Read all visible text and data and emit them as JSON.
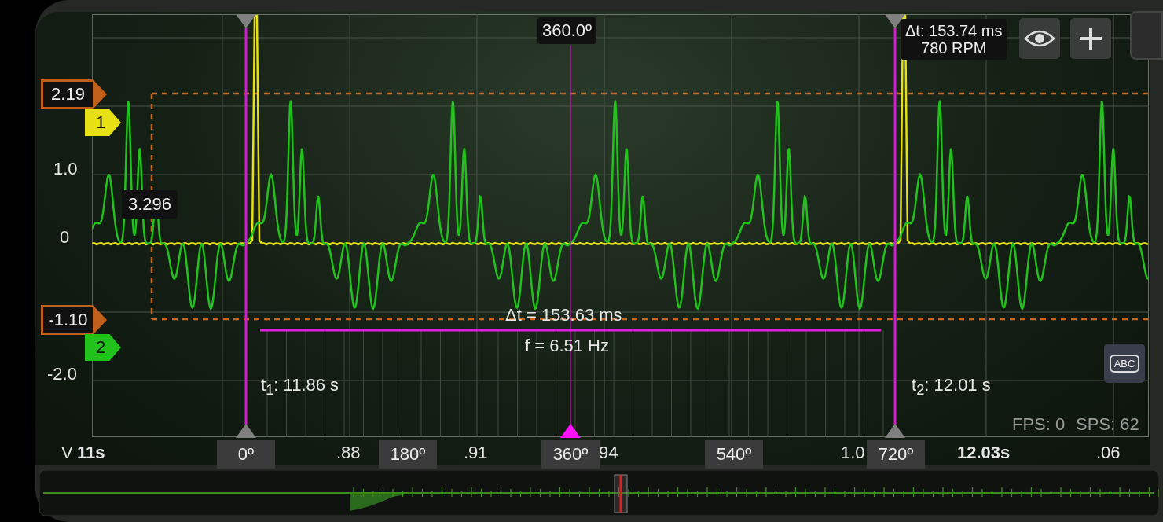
{
  "header": {
    "phase_readout": "360.0º",
    "delta_readout": {
      "delta": "Δt: 153.74 ms",
      "rpm": "780 RPM"
    }
  },
  "toolbar": [
    {
      "kind": "visibility"
    },
    {
      "kind": "add"
    }
  ],
  "y_axis": {
    "labels": [
      "1.0",
      "0",
      "-2.0"
    ]
  },
  "cursors": {
    "levels": [
      "2.19",
      "-1.10"
    ],
    "channels": [
      {
        "label": "1",
        "color": "#e6e014"
      },
      {
        "label": "2",
        "color": "#22c21c"
      }
    ],
    "probe_value": "3.296"
  },
  "measurement": {
    "delta": "Δt = 153.63 ms",
    "frequency": "f = 6.51 Hz",
    "t1": "t$_{1}$: 11.86 s",
    "t2": "t$_{2}$: 12.01 s"
  },
  "label_button": "ABC",
  "stats": [
    "FPS: 0",
    "SPS: 62"
  ],
  "x_axis": {
    "unit": "V",
    "labels": [
      {
        "text": "11s",
        "bold": true
      },
      {
        "text": ".88",
        "bold": false
      },
      {
        "text": ".91",
        "bold": false
      },
      {
        "text": "94",
        "bold": false
      },
      {
        "text": "1.0",
        "bold": false
      },
      {
        "text": "12.03s",
        "bold": true
      },
      {
        "text": ".06",
        "bold": false
      }
    ]
  },
  "phase_markers": [
    "0º",
    "180º",
    "360º",
    "540º",
    "720º"
  ]
}
